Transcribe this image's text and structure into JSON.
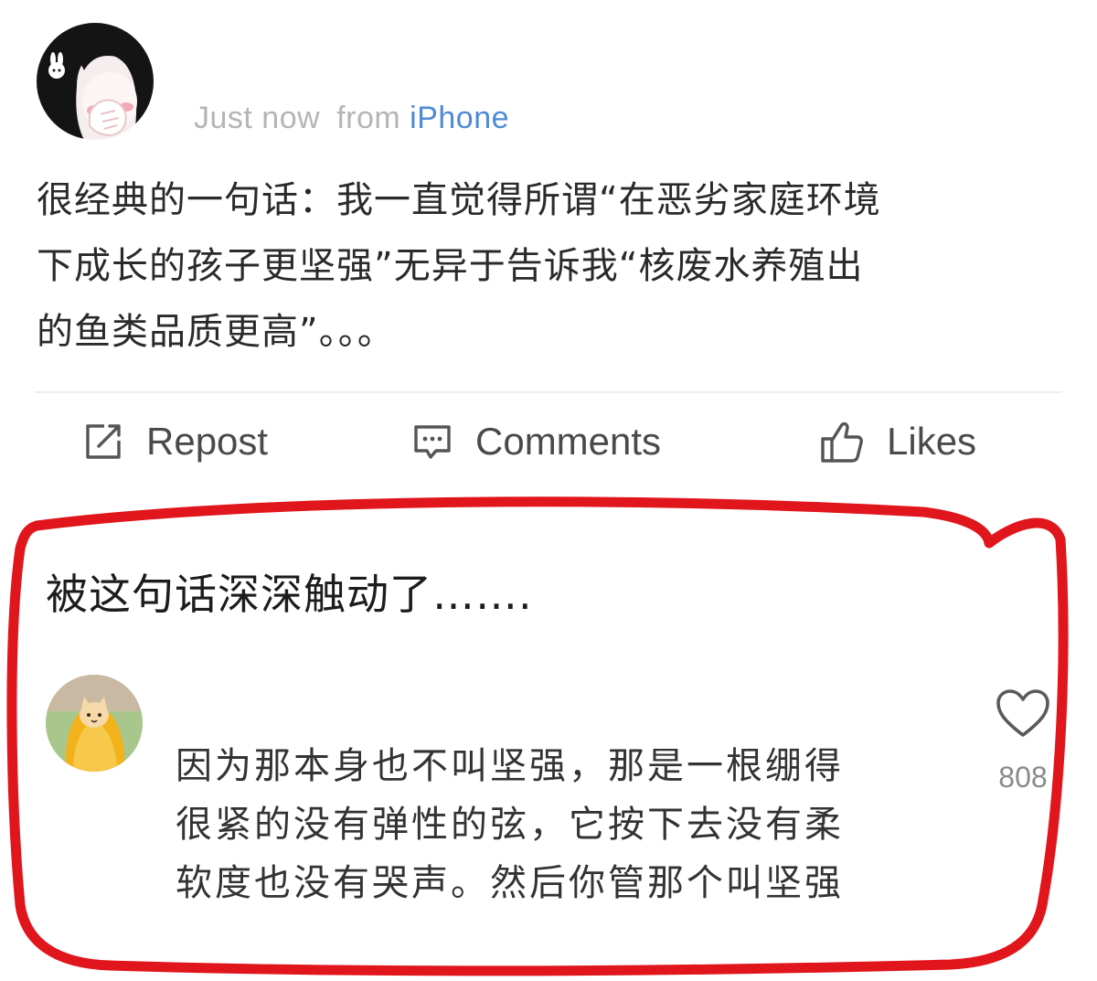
{
  "post": {
    "time": "Just now",
    "from_label": "from",
    "source": "iPhone",
    "text_lines": [
      "很经典的一句话：我一直觉得所谓“在恶劣家庭环境",
      "下成长的孩子更坚强”无异于告诉我“核废水养殖出",
      "的鱼类品质更高”。。。"
    ]
  },
  "actions": {
    "repost": "Repost",
    "comments": "Comments",
    "likes": "Likes"
  },
  "comment": {
    "headline": "被这句话深深触动了……."
  },
  "reply": {
    "text_lines": [
      "因为那本身也不叫坚强，那是一根绷得",
      "很紧的没有弹性的弦，它按下去没有柔",
      "软度也没有哭声。然后你管那个叫坚强"
    ],
    "like_count": "808"
  },
  "colors": {
    "annotation_red": "#e0161c",
    "link_blue": "#4e8bd4",
    "meta_gray": "#b5b5b5"
  }
}
